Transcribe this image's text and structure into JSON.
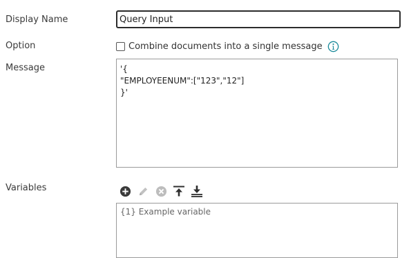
{
  "form": {
    "display_name_label": "Display Name",
    "display_name_value": "Query Input",
    "option_label": "Option",
    "option_checkbox_label": "Combine documents into a single message",
    "option_checked": false,
    "message_label": "Message",
    "message_value": "'{\n\"EMPLOYEENUM\":[\"123\",\"12\"]\n}'",
    "variables_label": "Variables",
    "variables_item": "{1} Example variable"
  },
  "toolbar": {
    "icons": [
      "add-icon",
      "edit-icon",
      "remove-icon",
      "move-top-icon",
      "move-bottom-icon"
    ]
  },
  "colors": {
    "info_icon": "#1a8a9a",
    "add_icon": "#3a3a3a",
    "disabled_icon": "#b8b8b8"
  }
}
